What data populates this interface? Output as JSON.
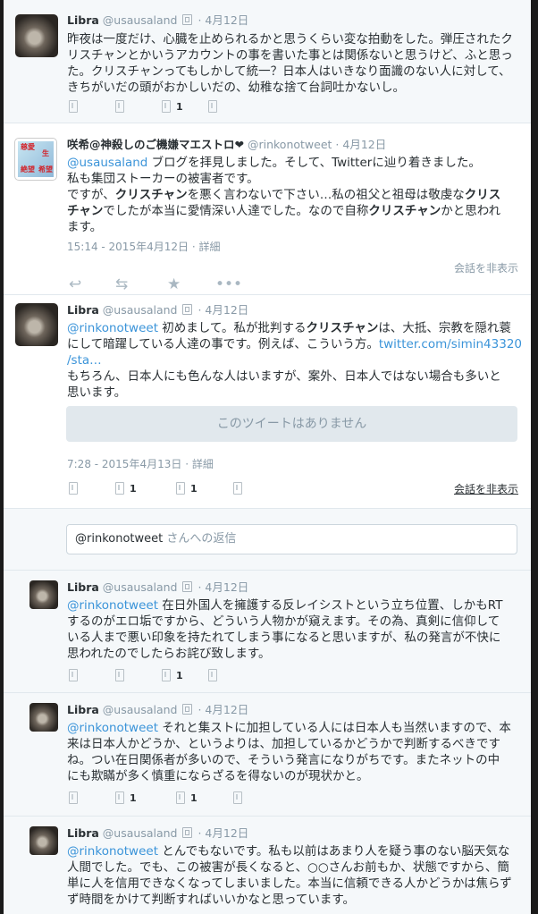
{
  "tweets": [
    {
      "name": "Libra",
      "handle": "@usausaland",
      "time": "4月12日",
      "text": "昨夜は一度だけ、心臓を止められるかと思うくらい変な拍動をした。弾圧されたクリスチャンとかいうアカウントの事を書いた事とは関係ないと思うけど、ふと思った。クリスチャンってもしかして統一？日本人はいきなり面識のない人に対して、きちがいだの頭がおかしいだの、幼稚な捨て台詞吐かないし。",
      "favorite_count": "1"
    },
    {
      "name": "咲希@神殺しのご機嫌マエストロ❤",
      "handle": "@rinkonotweet",
      "time": "4月12日",
      "mention": "@usausaland",
      "line1_rest": " ブログを拝見しました。そして、Twitterに辿り着きました。",
      "line2": "私も集団ストーカーの被害者です。",
      "line3_pre": "ですが、",
      "kw": "クリスチャン",
      "line3_post": "を悪く言わないで下さい…私の祖父と祖母は敬虔な",
      "line4_kw_tail": "チャン",
      "line4_mid": "でしたが本当に愛情深い人達でした。なので自称",
      "line4_post": "かと思われ",
      "line5": "ます。",
      "kw_head": "クリス",
      "meta_time": "15:14 - 2015年4月12日",
      "meta_detail": "詳細",
      "hide": "会話を非表示",
      "avatar_text1": "慈愛",
      "avatar_text2": "生",
      "avatar_text3": "絶望",
      "avatar_text4": "希望"
    },
    {
      "name": "Libra",
      "handle": "@usausaland",
      "time": "4月12日",
      "mention": "@rinkonotweet",
      "l1_mid": " 初めまして。私が批判する",
      "kw": "クリスチャン",
      "l1_post": "は、大抵、宗教を隠れ蓑",
      "l2": "にして暗躍している人達の事です。例えば、こういう方。",
      "l2_link": "twitter.com/simin43320",
      "l3_link": "/sta…",
      "l4": "もちろん、日本人にも色んな人はいますが、案外、日本人ではない場合も多いと",
      "l5": "思います。",
      "quoted": "このツイートはありません",
      "meta_time": "7:28 - 2015年4月13日",
      "meta_detail": "詳細",
      "retweet_count": "1",
      "favorite_count": "1",
      "hide": "会話を非表示"
    }
  ],
  "reply": {
    "mention": "@rinkonotweet",
    "placeholder_tail": " さんへの返信"
  },
  "replies": [
    {
      "name": "Libra",
      "handle": "@usausaland",
      "time": "4月12日",
      "mention": "@rinkonotweet",
      "l1": " 在日外国人を擁護する反レイシストという立ち位置、しかもRT",
      "l2": "するのがエロ垢ですから、どういう人物かが窺えます。その為、真剣に信仰して",
      "l3": "いる人まで悪い印象を持たれてしまう事になると思いますが、私の発言が不快に",
      "l4": "思われたのでしたらお詫び致します。",
      "favorite_count": "1"
    },
    {
      "name": "Libra",
      "handle": "@usausaland",
      "time": "4月12日",
      "mention": "@rinkonotweet",
      "l1": " それと集ストに加担している人には日本人も当然いますので、本",
      "l2": "来は日本人かどうか、というよりは、加担しているかどうかで判断するべきです",
      "l3": "ね。つい在日関係者が多いので、そういう発言になりがちです。またネットの中",
      "l4": "にも欺瞞が多く慎重にならざるを得ないのが現状かと。",
      "retweet_count": "1",
      "favorite_count": "1"
    },
    {
      "name": "Libra",
      "handle": "@usausaland",
      "time": "4月12日",
      "mention": "@rinkonotweet",
      "l1": " とんでもないです。私も以前はあまり人を疑う事のない脳天気な",
      "l2": "人間でした。でも、この被害が長くなると、○○さんお前もか、状態ですから、簡",
      "l3": "単に人を信用できなくなってしまいました。本当に信頼できる人かどうかは焦らず",
      "l4": "ず時間をかけて判断すればいいかなと思っています。"
    }
  ]
}
